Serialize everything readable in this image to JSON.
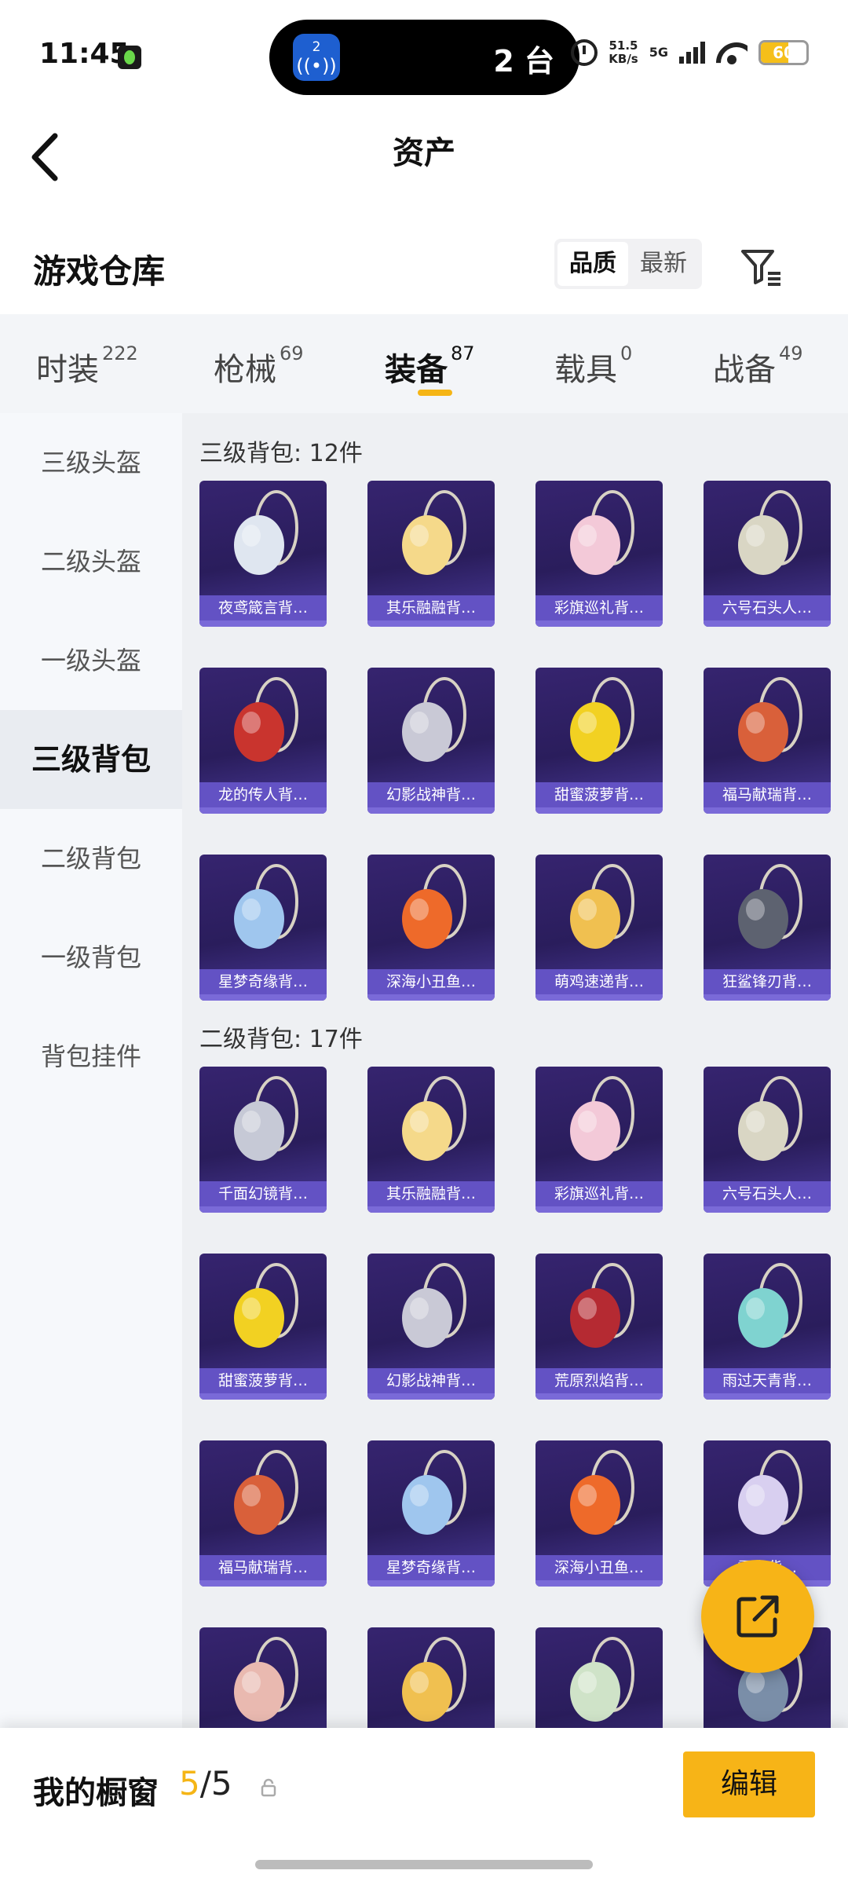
{
  "status_bar": {
    "time": "11:45",
    "island_badge": "2",
    "island_text": "2 台",
    "net_speed_value": "51.5",
    "net_speed_unit": "KB/s",
    "network": "5G",
    "battery": "60",
    "battery_level": 0.6,
    "battery_color": "#f5bf1a"
  },
  "header": {
    "title": "资产"
  },
  "section": {
    "title": "游戏仓库",
    "sort_options": [
      "品质",
      "最新"
    ],
    "active_sort": "品质"
  },
  "tabs": [
    {
      "label": "时装",
      "count": "222"
    },
    {
      "label": "枪械",
      "count": "69"
    },
    {
      "label": "装备",
      "count": "87",
      "active": true
    },
    {
      "label": "载具",
      "count": "0"
    },
    {
      "label": "战备",
      "count": "49"
    }
  ],
  "sidebar": {
    "items": [
      "三级头盔",
      "二级头盔",
      "一级头盔",
      "三级背包",
      "二级背包",
      "一级背包",
      "背包挂件"
    ],
    "active": "三级背包"
  },
  "groups": [
    {
      "title": "三级背包: 12件",
      "items": [
        {
          "label": "夜鸢箴言背…",
          "icon": "jellyfish-backpack-icon",
          "color": "#dfe6f0"
        },
        {
          "label": "其乐融融背…",
          "icon": "cupcake-backpack-icon",
          "color": "#f5d98a"
        },
        {
          "label": "彩旗巡礼背…",
          "icon": "ribbon-backpack-icon",
          "color": "#f3c9d8"
        },
        {
          "label": "六号石头人…",
          "icon": "stone-golem-backpack-icon",
          "color": "#d9d6c4"
        },
        {
          "label": "龙的传人背…",
          "icon": "dragon-backpack-icon",
          "color": "#c9342e"
        },
        {
          "label": "幻影战神背…",
          "icon": "phantom-backpack-icon",
          "color": "#c9c9d6"
        },
        {
          "label": "甜蜜菠萝背…",
          "icon": "pineapple-backpack-icon",
          "color": "#f2d122"
        },
        {
          "label": "福马献瑞背…",
          "icon": "horse-backpack-icon",
          "color": "#d9603a"
        },
        {
          "label": "星梦奇缘背…",
          "icon": "swan-backpack-icon",
          "color": "#9fc6ee"
        },
        {
          "label": "深海小丑鱼…",
          "icon": "clownfish-backpack-icon",
          "color": "#ee6a2a"
        },
        {
          "label": "萌鸡速递背…",
          "icon": "chick-backpack-icon",
          "color": "#f0c050"
        },
        {
          "label": "狂鲨锋刃背…",
          "icon": "shark-backpack-icon",
          "color": "#5d6270"
        }
      ]
    },
    {
      "title": "二级背包: 17件",
      "items": [
        {
          "label": "千面幻镜背…",
          "icon": "mirror-backpack-icon",
          "color": "#c6c9d6"
        },
        {
          "label": "其乐融融背…",
          "icon": "cupcake-backpack-icon",
          "color": "#f5d98a"
        },
        {
          "label": "彩旗巡礼背…",
          "icon": "ribbon-backpack-icon",
          "color": "#f3c9d8"
        },
        {
          "label": "六号石头人…",
          "icon": "stone-golem-backpack-icon",
          "color": "#d9d6c4"
        },
        {
          "label": "甜蜜菠萝背…",
          "icon": "pineapple-backpack-icon",
          "color": "#f2d122"
        },
        {
          "label": "幻影战神背…",
          "icon": "phantom-backpack-icon",
          "color": "#c9c9d6"
        },
        {
          "label": "荒原烈焰背…",
          "icon": "flame-backpack-icon",
          "color": "#b52a32"
        },
        {
          "label": "雨过天青背…",
          "icon": "celadon-backpack-icon",
          "color": "#7fd3d0"
        },
        {
          "label": "福马献瑞背…",
          "icon": "horse-backpack-icon",
          "color": "#d9603a"
        },
        {
          "label": "星梦奇缘背…",
          "icon": "swan-backpack-icon",
          "color": "#9fc6ee"
        },
        {
          "label": "深海小丑鱼…",
          "icon": "clownfish-backpack-icon",
          "color": "#ee6a2a"
        },
        {
          "label": "雪人背…",
          "icon": "snowman-backpack-icon",
          "color": "#d8cff0"
        },
        {
          "label": "",
          "icon": "floral-backpack-icon",
          "color": "#e9b9b0"
        },
        {
          "label": "",
          "icon": "chick-backpack-icon",
          "color": "#f0c050"
        },
        {
          "label": "",
          "icon": "leaf-backpack-icon",
          "color": "#cfe3c8"
        },
        {
          "label": "",
          "icon": "tech-backpack-icon",
          "color": "#7a8ea8"
        }
      ]
    }
  ],
  "bottom_bar": {
    "label": "我的橱窗",
    "current": "5",
    "separator": "/",
    "total": "5",
    "edit_label": "编辑"
  },
  "colors": {
    "accent": "#f5b516",
    "card_label_bg": "#6352c4",
    "card_bg": "#2a1d5c"
  }
}
